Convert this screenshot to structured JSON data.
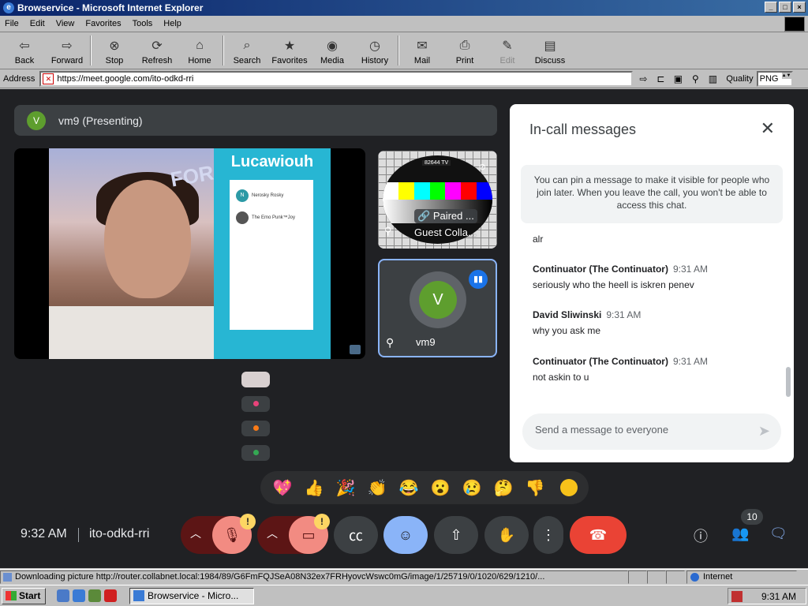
{
  "window": {
    "title": "Browservice - Microsoft Internet Explorer"
  },
  "menu": [
    "File",
    "Edit",
    "View",
    "Favorites",
    "Tools",
    "Help"
  ],
  "toolbar": [
    {
      "label": "Back",
      "icon": "back-arrow-icon",
      "glyph": "⇦"
    },
    {
      "label": "Forward",
      "icon": "forward-arrow-icon",
      "glyph": "⇨"
    },
    {
      "label": "Stop",
      "icon": "stop-icon",
      "glyph": "⊗"
    },
    {
      "label": "Refresh",
      "icon": "refresh-icon",
      "glyph": "⟳"
    },
    {
      "label": "Home",
      "icon": "home-icon",
      "glyph": "⌂"
    },
    {
      "label": "Search",
      "icon": "search-icon",
      "glyph": "⌕"
    },
    {
      "label": "Favorites",
      "icon": "favorites-icon",
      "glyph": "★"
    },
    {
      "label": "Media",
      "icon": "media-icon",
      "glyph": "◉"
    },
    {
      "label": "History",
      "icon": "history-icon",
      "glyph": "◷"
    },
    {
      "label": "Mail",
      "icon": "mail-icon",
      "glyph": "✉"
    },
    {
      "label": "Print",
      "icon": "print-icon",
      "glyph": "⎙"
    },
    {
      "label": "Edit",
      "icon": "edit-icon",
      "glyph": "✎"
    },
    {
      "label": "Discuss",
      "icon": "discuss-icon",
      "glyph": "▤"
    }
  ],
  "address": {
    "label": "Address",
    "url": "https://meet.google.com/ito-odkd-rri",
    "quality_label": "Quality",
    "quality_value": "PNG"
  },
  "meet": {
    "presenting_name": "vm9 (Presenting)",
    "presenter_initial": "V",
    "screen_title": "Lucawiouh",
    "screen_users": [
      {
        "initial": "N",
        "name": "Nerosky Rosky"
      },
      {
        "initial": "",
        "name": "The Emo Punk™Joy"
      }
    ],
    "screen_overlay_text": "FOR",
    "tv_label": "82644 TV",
    "paired_label": "Paired ...",
    "guest_label": "Guest Colla...",
    "vm_initial": "V",
    "vm_name": "vm9",
    "reactions": [
      "💖",
      "👍",
      "🎉",
      "👏",
      "😂",
      "😮",
      "😢",
      "🤔",
      "👎"
    ],
    "clock": "9:32 AM",
    "meeting_code": "ito-odkd-rri",
    "people_count": "10",
    "accent": "#8ab4f8",
    "end_color": "#ea4335"
  },
  "chat": {
    "title": "In-call messages",
    "notice": "You can pin a message to make it visible for people who join later. When you leave the call, you won't be able to access this chat.",
    "messages": [
      {
        "author": "",
        "time": "",
        "text": "alr"
      },
      {
        "author": "Continuator (The Continuator)",
        "time": "9:31 AM",
        "text": "seriously who the heell is iskren penev"
      },
      {
        "author": "David Sliwinski",
        "time": "9:31 AM",
        "text": "why you ask me"
      },
      {
        "author": "Continuator (The Continuator)",
        "time": "9:31 AM",
        "text": "not askin to u"
      }
    ],
    "input_placeholder": "Send a message to everyone"
  },
  "statusbar": {
    "text": "Downloading picture http://router.collabnet.local:1984/89/G6FmFQJSeA08N32ex7FRHyovcWswc0mG/image/1/25719/0/1020/629/1210/...",
    "zone": "Internet"
  },
  "taskbar": {
    "start": "Start",
    "task": "Browservice - Micro...",
    "time": "9:31 AM"
  }
}
